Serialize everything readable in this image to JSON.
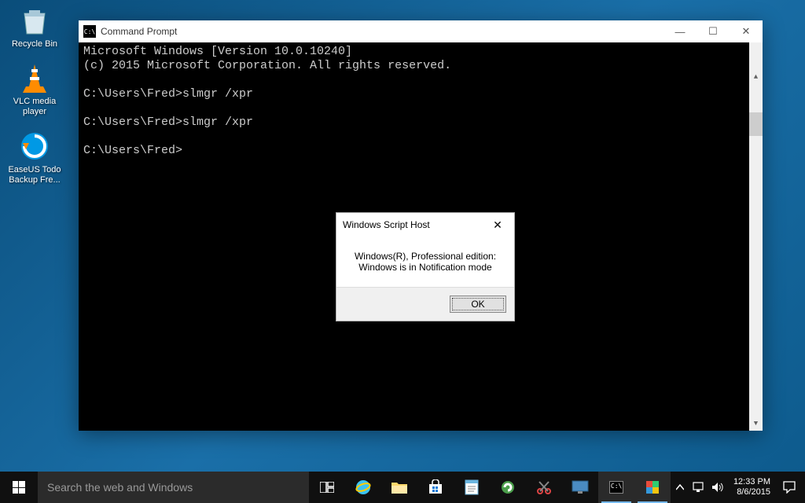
{
  "desktop": {
    "icons": [
      {
        "label": "Recycle Bin",
        "icon": "recycle-bin"
      },
      {
        "label": "VLC media player",
        "icon": "vlc"
      },
      {
        "label": "EaseUS Todo Backup Fre...",
        "icon": "easeus"
      }
    ]
  },
  "cmd": {
    "title": "Command Prompt",
    "lines": "Microsoft Windows [Version 10.0.10240]\n(c) 2015 Microsoft Corporation. All rights reserved.\n\nC:\\Users\\Fred>slmgr /xpr\n\nC:\\Users\\Fred>slmgr /xpr\n\nC:\\Users\\Fred>"
  },
  "dialog": {
    "title": "Windows Script Host",
    "line1": "Windows(R), Professional edition:",
    "line2": "Windows is in Notification mode",
    "ok": "OK"
  },
  "taskbar": {
    "search_placeholder": "Search the web and Windows",
    "time": "12:33 PM",
    "date": "8/6/2015"
  }
}
